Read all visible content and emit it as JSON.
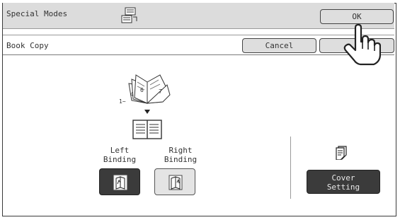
{
  "header": {
    "title": "Special Modes",
    "ok_label": "OK"
  },
  "subheader": {
    "title": "Book Copy",
    "cancel_label": "Cancel"
  },
  "illustration": {
    "page_range_label": "1~",
    "page_numbers": [
      "4",
      "6",
      "7"
    ]
  },
  "binding": {
    "left_label_line1": "Left",
    "left_label_line2": "Binding",
    "right_label_line1": "Right",
    "right_label_line2": "Binding",
    "selected": "left"
  },
  "cover": {
    "label_line1": "Cover",
    "label_line2": "Setting"
  },
  "icons": {
    "mode": "special-modes-icon",
    "pointer": "hand-pointer-icon",
    "book": "book-icon",
    "cover": "cover-page-icon",
    "left_binding": "left-binding-icon",
    "right_binding": "right-binding-icon"
  }
}
